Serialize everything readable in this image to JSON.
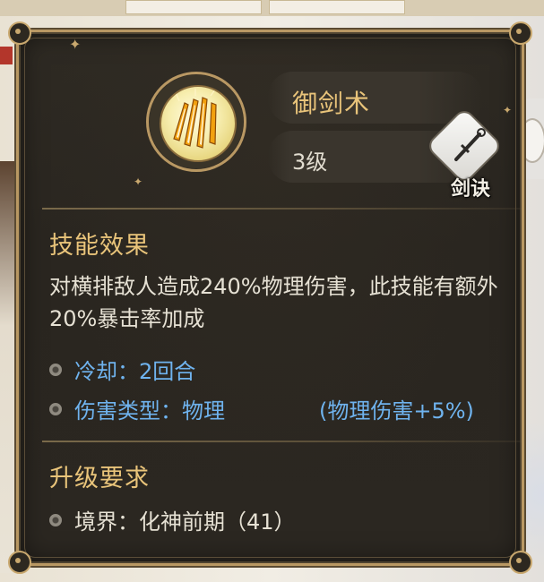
{
  "skill": {
    "name": "御剑术",
    "level": "3级",
    "tag_label": "剑诀"
  },
  "effect": {
    "title": "技能效果",
    "description": "对横排敌人造成240%物理伤害，此技能有额外20%暴击率加成",
    "cooldown": "冷却：2回合",
    "damage_type": "伤害类型：物理",
    "damage_bonus": "(物理伤害+5%)"
  },
  "upgrade": {
    "title": "升级要求",
    "realm": "境界：化神前期（41）"
  },
  "colors": {
    "title_gold": "#e9c47a",
    "info_blue": "#6fb3ee",
    "body_text": "#e6e1d4",
    "panel_bg": "#2b2721",
    "frame_gold": "#b99863"
  }
}
